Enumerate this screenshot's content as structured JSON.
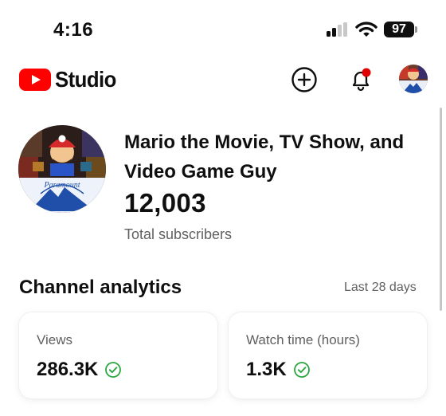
{
  "status_bar": {
    "time": "4:16",
    "battery": "97",
    "icons": [
      "cellular-signal-icon",
      "wifi-icon",
      "battery-icon"
    ]
  },
  "header": {
    "logo_text": "Studio",
    "icons": [
      "youtube-logo-icon",
      "create-icon",
      "notifications-bell-icon",
      "account-avatar"
    ],
    "brand_color": "#ff0000",
    "notification_dot_color": "#e00000"
  },
  "channel": {
    "name": "Mario the Movie, TV Show, and Video Game Guy",
    "subscribers": "12,003",
    "subscribers_label": "Total subscribers",
    "avatar_logo_text": "Paramount"
  },
  "analytics": {
    "title": "Channel analytics",
    "period": "Last 28 days",
    "cards": [
      {
        "label": "Views",
        "value": "286.3K",
        "status_icon": "check-circle-icon"
      },
      {
        "label": "Watch time (hours)",
        "value": "1.3K",
        "status_icon": "check-circle-icon"
      }
    ],
    "check_color": "#2ba640"
  }
}
